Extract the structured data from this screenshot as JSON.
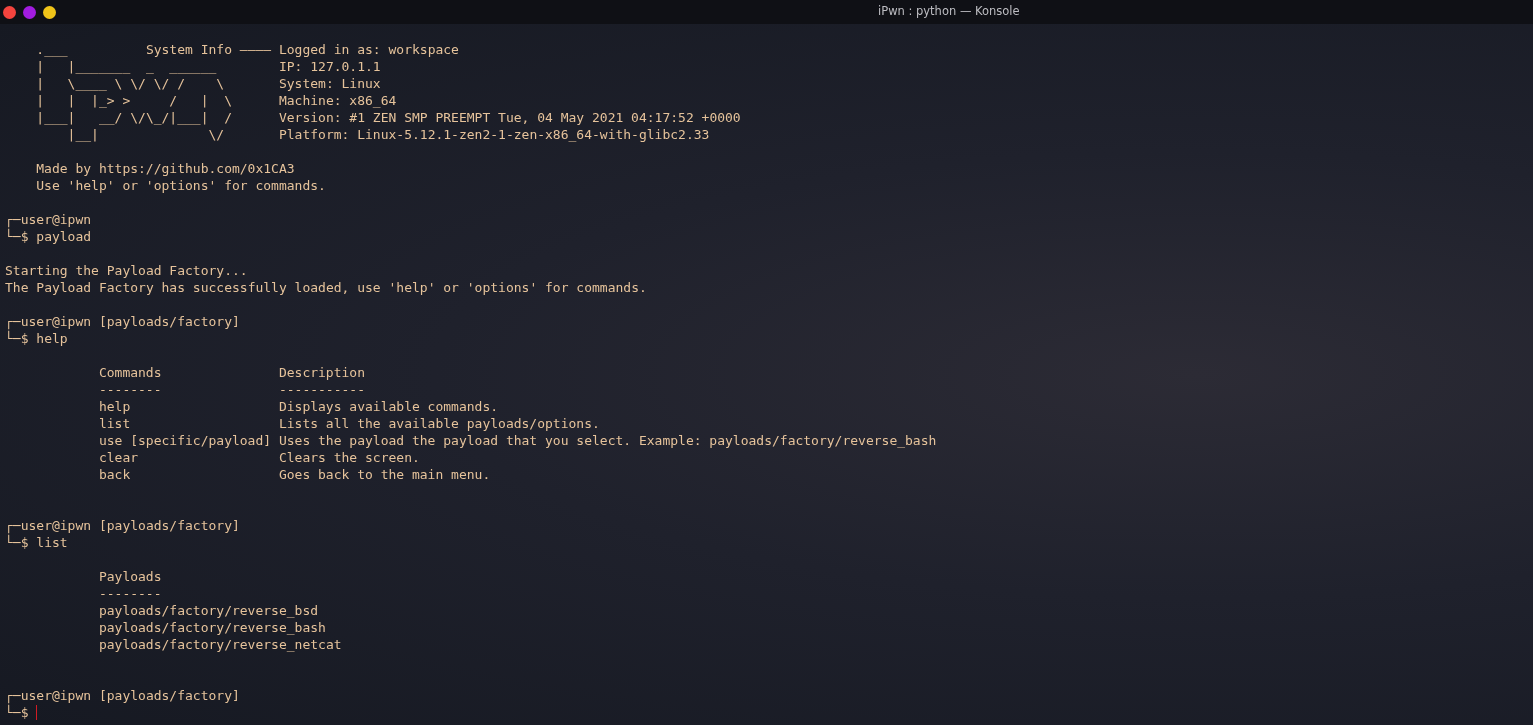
{
  "window": {
    "title": "iPwn : python — Konsole",
    "controls": [
      {
        "color": "#f4443e"
      },
      {
        "color": "#a21ce0"
      },
      {
        "color": "#f0c419"
      }
    ]
  },
  "banner": {
    "art": [
      "    .___          System Info ————",
      "    |   |_______  _  ______",
      "    |   \\____ \\ \\/ \\/ /    \\",
      "    |   |  |_> >     /   |  \\",
      "    |___|   __/ \\/\\_/|___|  /",
      "        |__|              \\/"
    ],
    "info": [
      "Logged in as: workspace",
      "IP: 127.0.1.1",
      "System: Linux",
      "Machine: x86_64",
      "Version: #1 ZEN SMP PREEMPT Tue, 04 May 2021 04:17:52 +0000",
      "Platform: Linux-5.12.1-zen2-1-zen-x86_64-with-glibc2.33"
    ],
    "credits": [
      "Made by https://github.com/0x1CA3",
      "Use 'help' or 'options' for commands."
    ]
  },
  "session": [
    {
      "kind": "prompt",
      "user_line": "┌─user@ipwn",
      "command_line": "└─$ payload"
    },
    {
      "kind": "output",
      "lines": [
        "Starting the Payload Factory...",
        "The Payload Factory has successfully loaded, use 'help' or 'options' for commands."
      ]
    },
    {
      "kind": "prompt",
      "user_line": "┌─user@ipwn [payloads/factory]",
      "command_line": "└─$ help"
    },
    {
      "kind": "table",
      "columns": [
        {
          "header": "Commands",
          "rule": "--------"
        },
        {
          "header": "Description",
          "rule": "-----------"
        }
      ],
      "rows": [
        [
          "help",
          "Displays available commands."
        ],
        [
          "list",
          "Lists all the available payloads/options."
        ],
        [
          "use [specific/payload]",
          "Uses the payload the payload that you select. Example: payloads/factory/reverse_bash"
        ],
        [
          "clear",
          "Clears the screen."
        ],
        [
          "back",
          "Goes back to the main menu."
        ]
      ]
    },
    {
      "kind": "prompt",
      "user_line": "┌─user@ipwn [payloads/factory]",
      "command_line": "└─$ list"
    },
    {
      "kind": "table",
      "columns": [
        {
          "header": "Payloads",
          "rule": "--------"
        }
      ],
      "rows": [
        [
          "payloads/factory/reverse_bsd"
        ],
        [
          "payloads/factory/reverse_bash"
        ],
        [
          "payloads/factory/reverse_netcat"
        ]
      ]
    },
    {
      "kind": "prompt",
      "user_line": "┌─user@ipwn [payloads/factory]",
      "command_line": "└─$",
      "cursor": true
    }
  ]
}
